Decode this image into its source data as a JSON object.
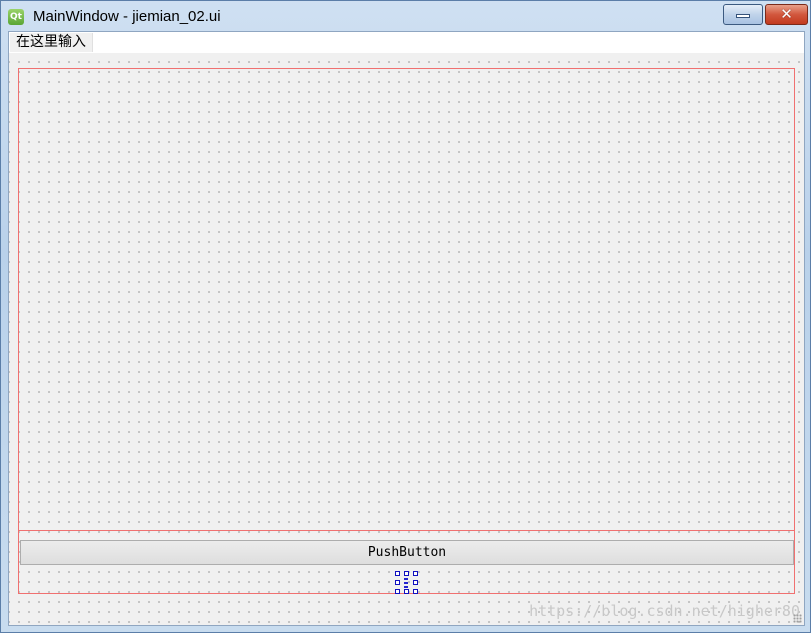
{
  "window": {
    "title": "MainWindow - jiemian_02.ui",
    "app_icon_text": "Qt"
  },
  "title_buttons": {
    "minimize_icon": "minimize-icon",
    "close_icon": "close-icon",
    "close_glyph": "✕"
  },
  "menubar": {
    "items": [
      {
        "label": "在这里输入"
      }
    ]
  },
  "central": {
    "push_button_label": "PushButton"
  },
  "watermark": {
    "text": "https://blog.csdn.net/higher80"
  },
  "colors": {
    "layout_border": "#f07070",
    "spacer": "#2323d0",
    "close_button": "#c23a1f"
  }
}
